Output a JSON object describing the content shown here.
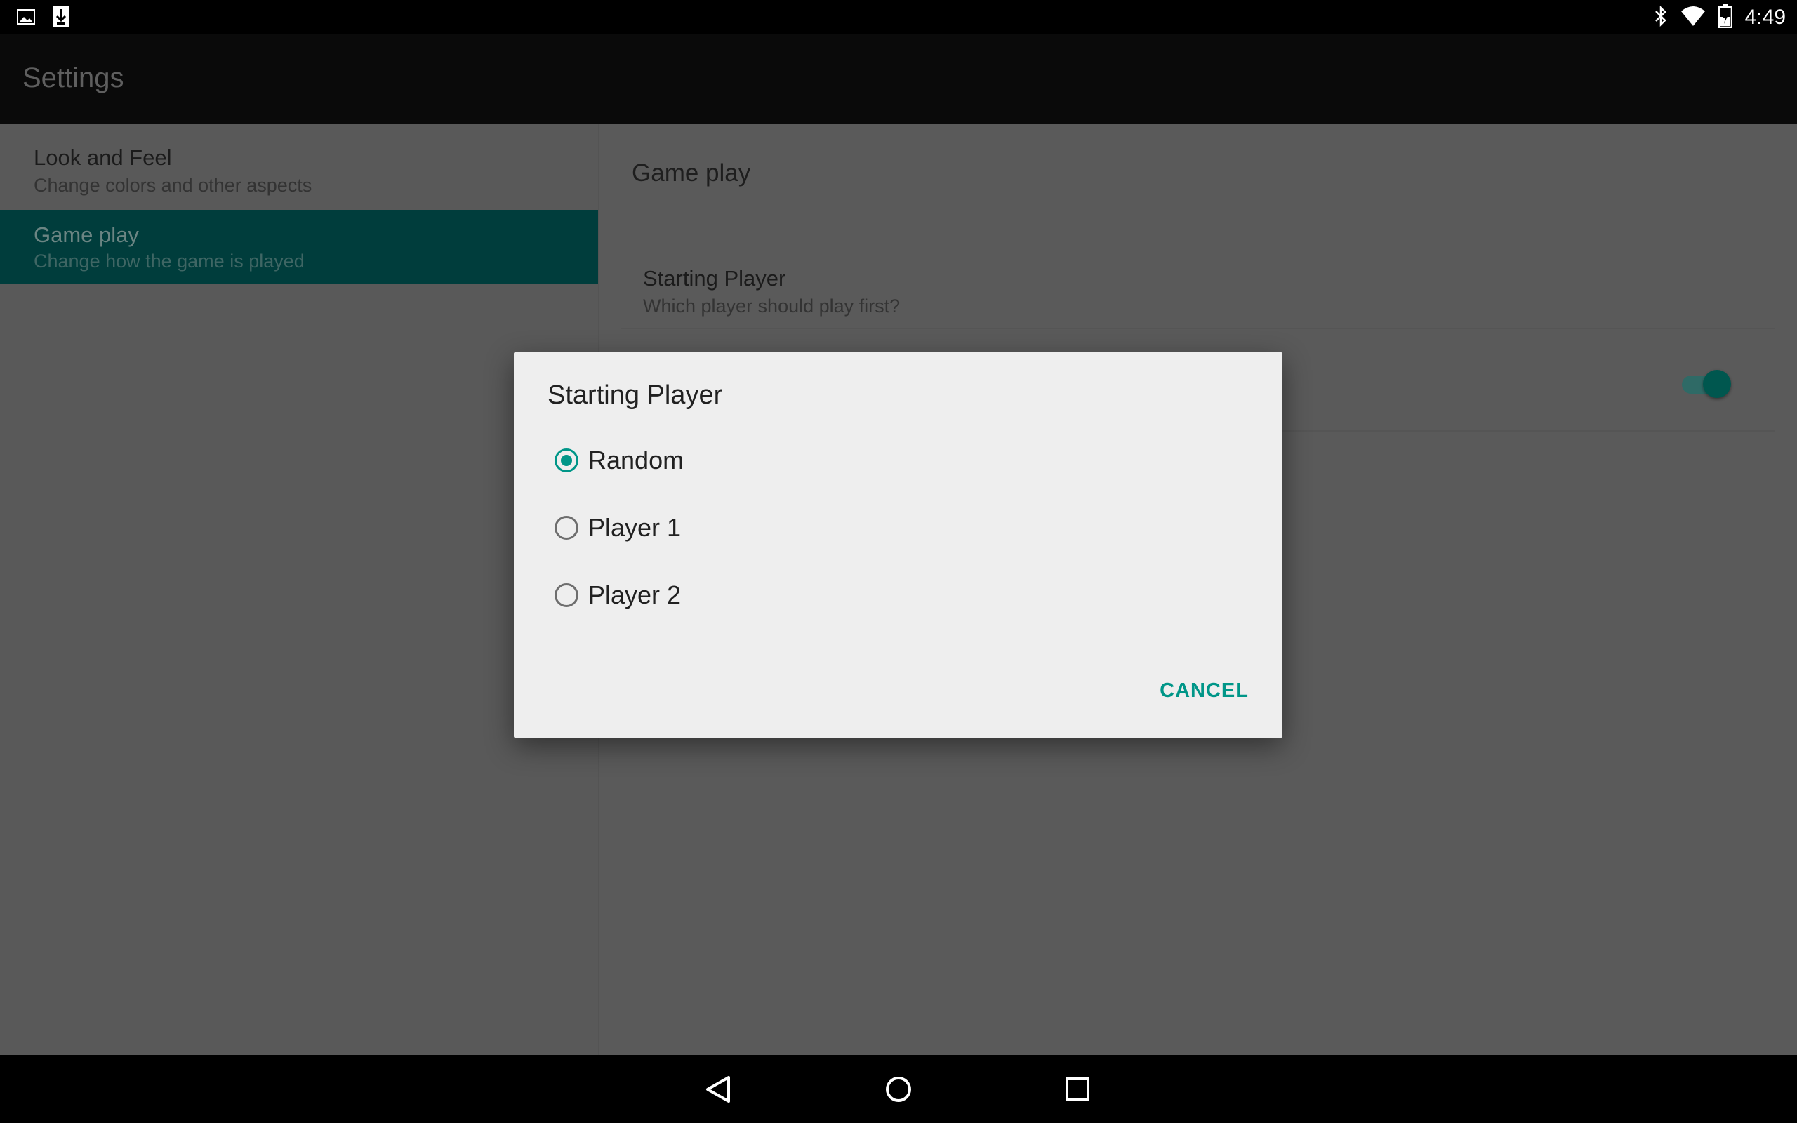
{
  "status_bar": {
    "time": "4:49",
    "left_icons": [
      "gallery-icon",
      "download-icon"
    ],
    "right_icons": [
      "bluetooth-icon",
      "wifi-icon",
      "battery-icon"
    ]
  },
  "app_bar": {
    "title": "Settings"
  },
  "headers": [
    {
      "title": "Look and Feel",
      "summary": "Change colors and other aspects",
      "selected": false
    },
    {
      "title": "Game play",
      "summary": "Change how the game is played",
      "selected": true
    }
  ],
  "detail": {
    "title": "Game play",
    "preferences": [
      {
        "title": "Starting Player",
        "summary": "Which player should play first?"
      },
      {
        "title": "",
        "summary": "",
        "switch_on": true
      }
    ]
  },
  "dialog": {
    "title": "Starting Player",
    "options": [
      {
        "label": "Random",
        "checked": true
      },
      {
        "label": "Player 1",
        "checked": false
      },
      {
        "label": "Player 2",
        "checked": false
      }
    ],
    "cancel_label": "CANCEL"
  },
  "colors": {
    "accent": "#009688",
    "selected_header_bg": "#003d3c"
  },
  "nav_bar": {
    "buttons": [
      "back-icon",
      "home-icon",
      "recents-icon"
    ]
  }
}
